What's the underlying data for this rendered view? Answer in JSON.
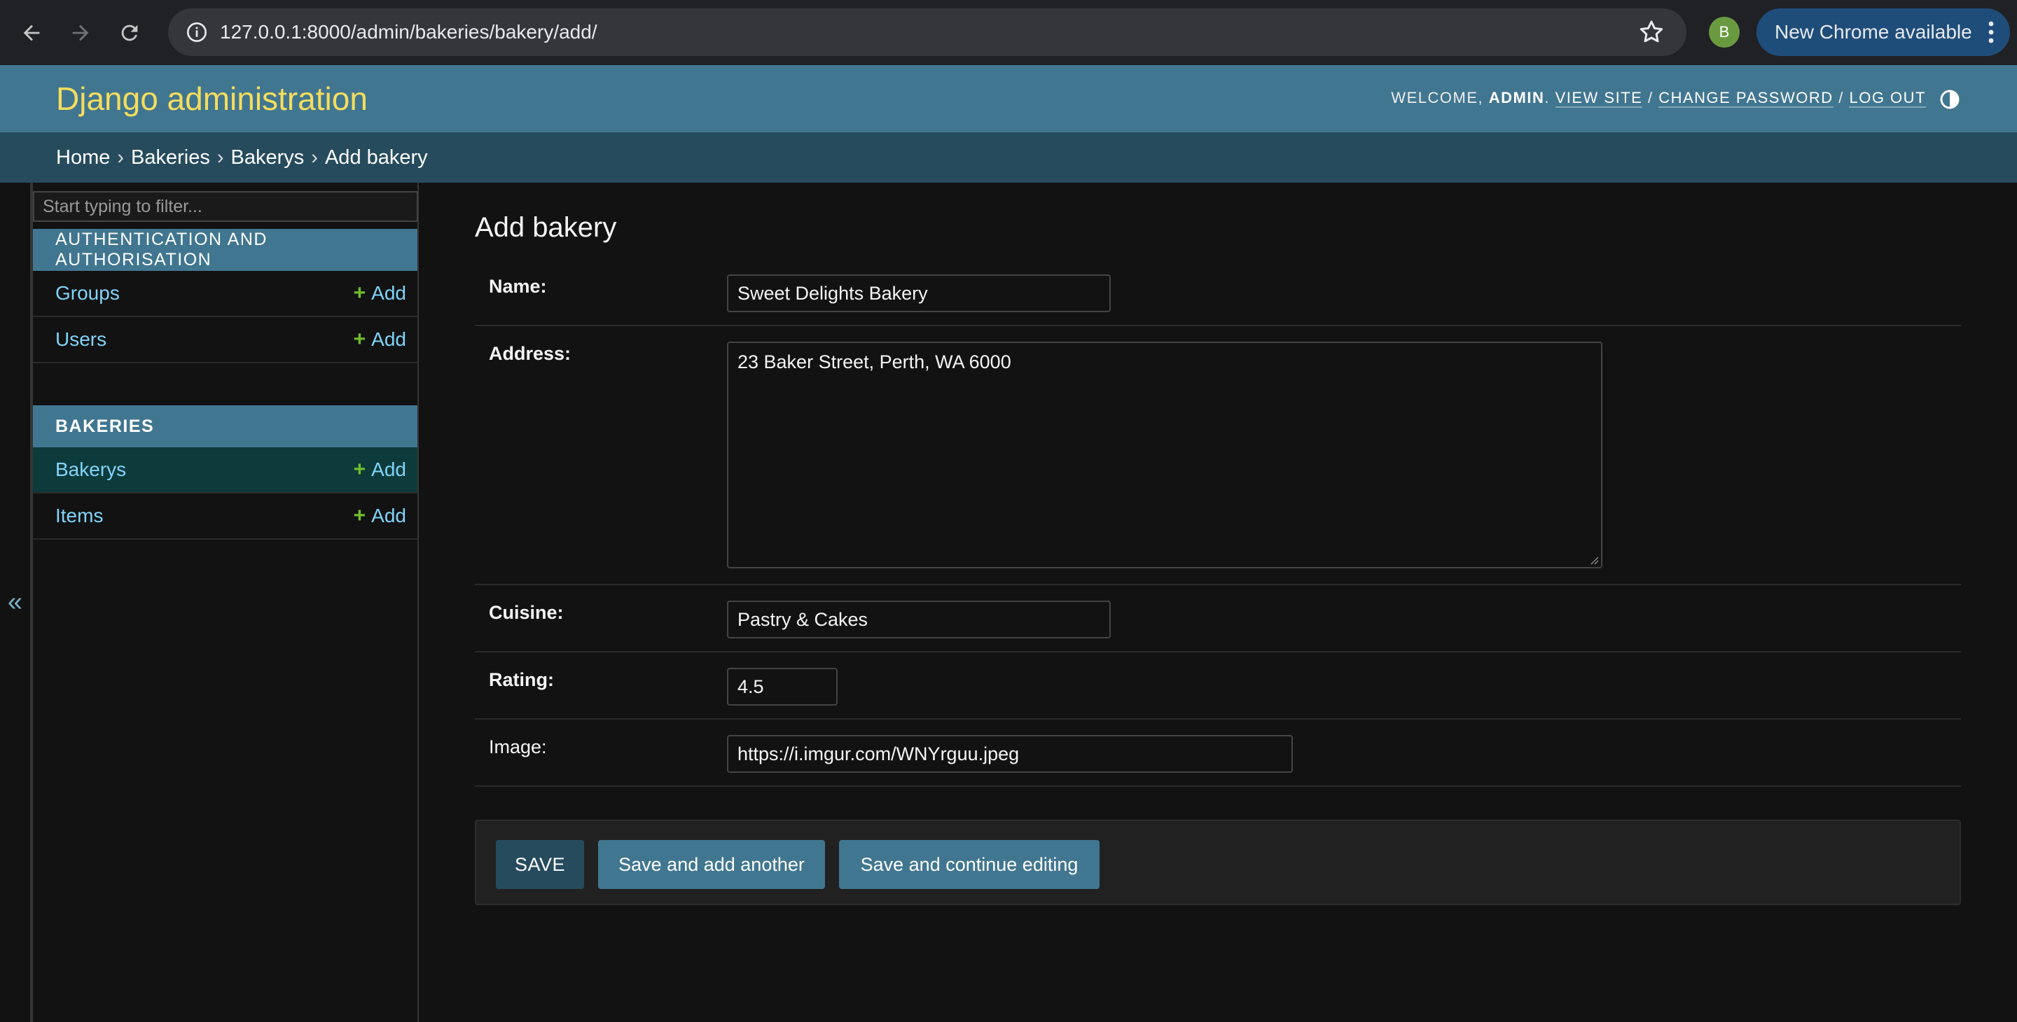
{
  "browser": {
    "url": "127.0.0.1:8000/admin/bakeries/bakery/add/",
    "profile_initial": "B",
    "update_label": "New Chrome available"
  },
  "header": {
    "brand": "Django administration",
    "welcome": "WELCOME,",
    "username": "ADMIN",
    "view_site": "VIEW SITE",
    "change_password": "CHANGE PASSWORD",
    "log_out": "LOG OUT"
  },
  "breadcrumbs": {
    "home": "Home",
    "app": "Bakeries",
    "model": "Bakerys",
    "current": "Add bakery"
  },
  "sidebar": {
    "filter_placeholder": "Start typing to filter...",
    "toggle": "«",
    "modules": [
      {
        "caption": "AUTHENTICATION AND AUTHORISATION",
        "models": [
          {
            "name": "Groups",
            "add": "Add"
          },
          {
            "name": "Users",
            "add": "Add"
          }
        ]
      },
      {
        "caption": "BAKERIES",
        "models": [
          {
            "name": "Bakerys",
            "add": "Add"
          },
          {
            "name": "Items",
            "add": "Add"
          }
        ]
      }
    ]
  },
  "form": {
    "title": "Add bakery",
    "fields": [
      {
        "label": "Name:",
        "value": "Sweet Delights Bakery"
      },
      {
        "label": "Address:",
        "value": "23 Baker Street, Perth, WA 6000"
      },
      {
        "label": "Cuisine:",
        "value": "Pastry & Cakes"
      },
      {
        "label": "Rating:",
        "value": "4.5"
      },
      {
        "label": "Image:",
        "value": "https://i.imgur.com/WNYrguu.jpeg"
      }
    ]
  },
  "buttons": {
    "save": "SAVE",
    "save_add_another": "Save and add another",
    "save_continue": "Save and continue editing"
  },
  "colors": {
    "header_bg": "#417690",
    "brand": "#f5dd5d",
    "breadcrumbs_bg": "#264b5d",
    "link": "#81d4fa",
    "add_plus": "#70bf2b",
    "current_row": "#0d3b3b",
    "page_bg": "#121212"
  }
}
